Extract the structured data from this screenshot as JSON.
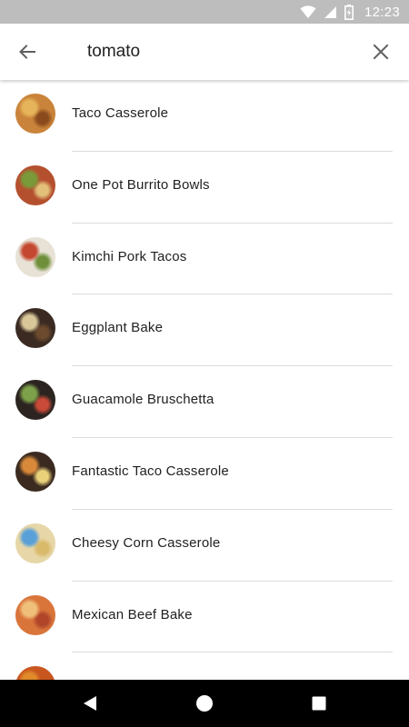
{
  "status_bar": {
    "time": "12:23",
    "icons": [
      "wifi-icon",
      "signal-icon",
      "battery-charging-icon"
    ]
  },
  "search": {
    "query": "tomato",
    "back_icon": "arrow-left-icon",
    "clear_icon": "close-icon"
  },
  "results": [
    {
      "title": "Taco Casserole",
      "thumb_colors": [
        "#c9833a",
        "#e6b45a",
        "#8a4a1c"
      ]
    },
    {
      "title": "One Pot Burrito Bowls",
      "thumb_colors": [
        "#b5502f",
        "#7a9a3a",
        "#e3c07a"
      ]
    },
    {
      "title": "Kimchi Pork Tacos",
      "thumb_colors": [
        "#e8e2d6",
        "#c4472f",
        "#6f8f3a"
      ]
    },
    {
      "title": "Eggplant Bake",
      "thumb_colors": [
        "#3a2a22",
        "#d9c79a",
        "#6b4a2e"
      ]
    },
    {
      "title": "Guacamole Bruschetta",
      "thumb_colors": [
        "#2b2420",
        "#7da04a",
        "#c94a38"
      ]
    },
    {
      "title": "Fantastic Taco Casserole",
      "thumb_colors": [
        "#3b2a1f",
        "#d88a3a",
        "#e9d27a"
      ]
    },
    {
      "title": "Cheesy Corn Casserole",
      "thumb_colors": [
        "#e7d7a8",
        "#5aa0d8",
        "#d9b96a"
      ]
    },
    {
      "title": "Mexican Beef Bake",
      "thumb_colors": [
        "#d9743a",
        "#f0c07a",
        "#b0452a"
      ]
    },
    {
      "title": "",
      "thumb_colors": [
        "#c9561f",
        "#e08a2a",
        "#f0b04a"
      ]
    }
  ],
  "nav_bar": {
    "icons": [
      "nav-back-icon",
      "nav-home-icon",
      "nav-recents-icon"
    ]
  }
}
